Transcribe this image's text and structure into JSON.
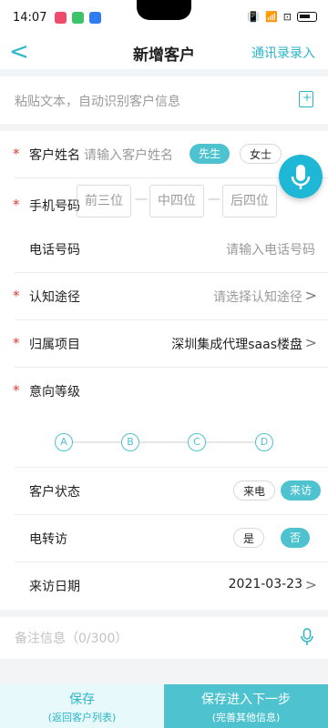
{
  "status": {
    "time": "14:07",
    "battery": "90"
  },
  "nav": {
    "back": "<",
    "title": "新增客户",
    "action": "通讯录录入"
  },
  "paste": {
    "placeholder": "粘贴文本，自动识别客户信息"
  },
  "form": {
    "name": {
      "label": "客户姓名",
      "placeholder": "请输入客户姓名",
      "opt_mr": "先生",
      "opt_ms": "女士"
    },
    "mobile": {
      "label": "手机号码",
      "p1": "前三位",
      "p2": "中四位",
      "p3": "后四位",
      "sep": "—"
    },
    "phone": {
      "label": "电话号码",
      "placeholder": "请输入电话号码"
    },
    "channel": {
      "label": "认知途径",
      "placeholder": "请选择认知途径",
      "chev": ">"
    },
    "project": {
      "label": "归属项目",
      "value": "深圳集成代理saas楼盘",
      "chev": ">"
    },
    "level": {
      "label": "意向等级",
      "levels": [
        "A",
        "B",
        "C",
        "D"
      ]
    },
    "status": {
      "label": "客户状态",
      "opt1": "来电",
      "opt2": "来访"
    },
    "transfer": {
      "label": "电转访",
      "opt1": "是",
      "opt2": "否"
    },
    "visit_date": {
      "label": "来访日期",
      "value": "2021-03-23",
      "chev": ">"
    }
  },
  "required_mark": "*",
  "note": {
    "placeholder": "备注信息（0/300）"
  },
  "bottom": {
    "save": {
      "label": "保存",
      "sub": "(返回客户列表)"
    },
    "next": {
      "label": "保存进入下一步",
      "sub": "(完善其他信息)"
    }
  },
  "colors": {
    "accent": "#4ec3cf",
    "accent_text": "#2bb5c7",
    "required": "#e53935",
    "fab": "#1fb7d6"
  }
}
